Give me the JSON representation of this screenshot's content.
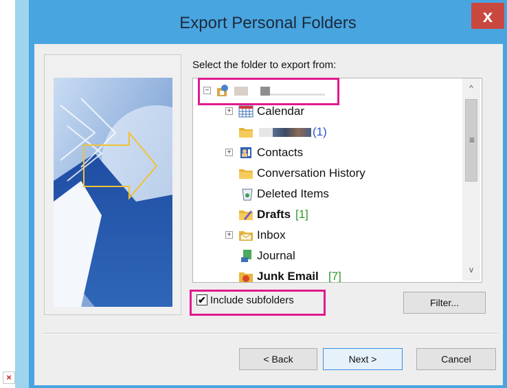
{
  "window": {
    "title": "Export Personal Folders",
    "close_glyph": "x"
  },
  "main": {
    "instruction": "Select the folder to export from:",
    "tree": [
      {
        "label": "",
        "count": "",
        "icon": "mailbox-icon",
        "expander": "−",
        "bold": false
      },
      {
        "label": "Calendar",
        "count": "",
        "icon": "calendar-icon",
        "expander": "+",
        "bold": false
      },
      {
        "label": "",
        "count": "(1)",
        "icon": "folder-icon",
        "expander": "",
        "bold": false
      },
      {
        "label": "Contacts",
        "count": "",
        "icon": "contacts-icon",
        "expander": "+",
        "bold": false
      },
      {
        "label": "Conversation History",
        "count": "",
        "icon": "folder-icon",
        "expander": "",
        "bold": false
      },
      {
        "label": "Deleted Items",
        "count": "",
        "icon": "trash-icon",
        "expander": "",
        "bold": false
      },
      {
        "label": "Drafts",
        "count": "[1]",
        "icon": "drafts-icon",
        "expander": "",
        "bold": true
      },
      {
        "label": "Inbox",
        "count": "",
        "icon": "inbox-icon",
        "expander": "+",
        "bold": false
      },
      {
        "label": "Journal",
        "count": "",
        "icon": "journal-icon",
        "expander": "",
        "bold": false
      },
      {
        "label": "Junk Email",
        "count": "[7]",
        "icon": "junk-icon",
        "expander": "",
        "bold": true
      }
    ],
    "scroll_up_glyph": "^",
    "scroll_down_glyph": "v",
    "scroll_grip_glyph": "≡",
    "include_subfolders": {
      "label": "Include subfolders",
      "checked": true,
      "check_glyph": "✔"
    },
    "filter_label": "Filter..."
  },
  "footer": {
    "back_label": "< Back",
    "next_label": "Next >",
    "cancel_label": "Cancel"
  },
  "colors": {
    "highlight": "#e0198f",
    "titlebar": "#49a5e0",
    "close": "#c9483f"
  },
  "broken_image_glyph": "×"
}
